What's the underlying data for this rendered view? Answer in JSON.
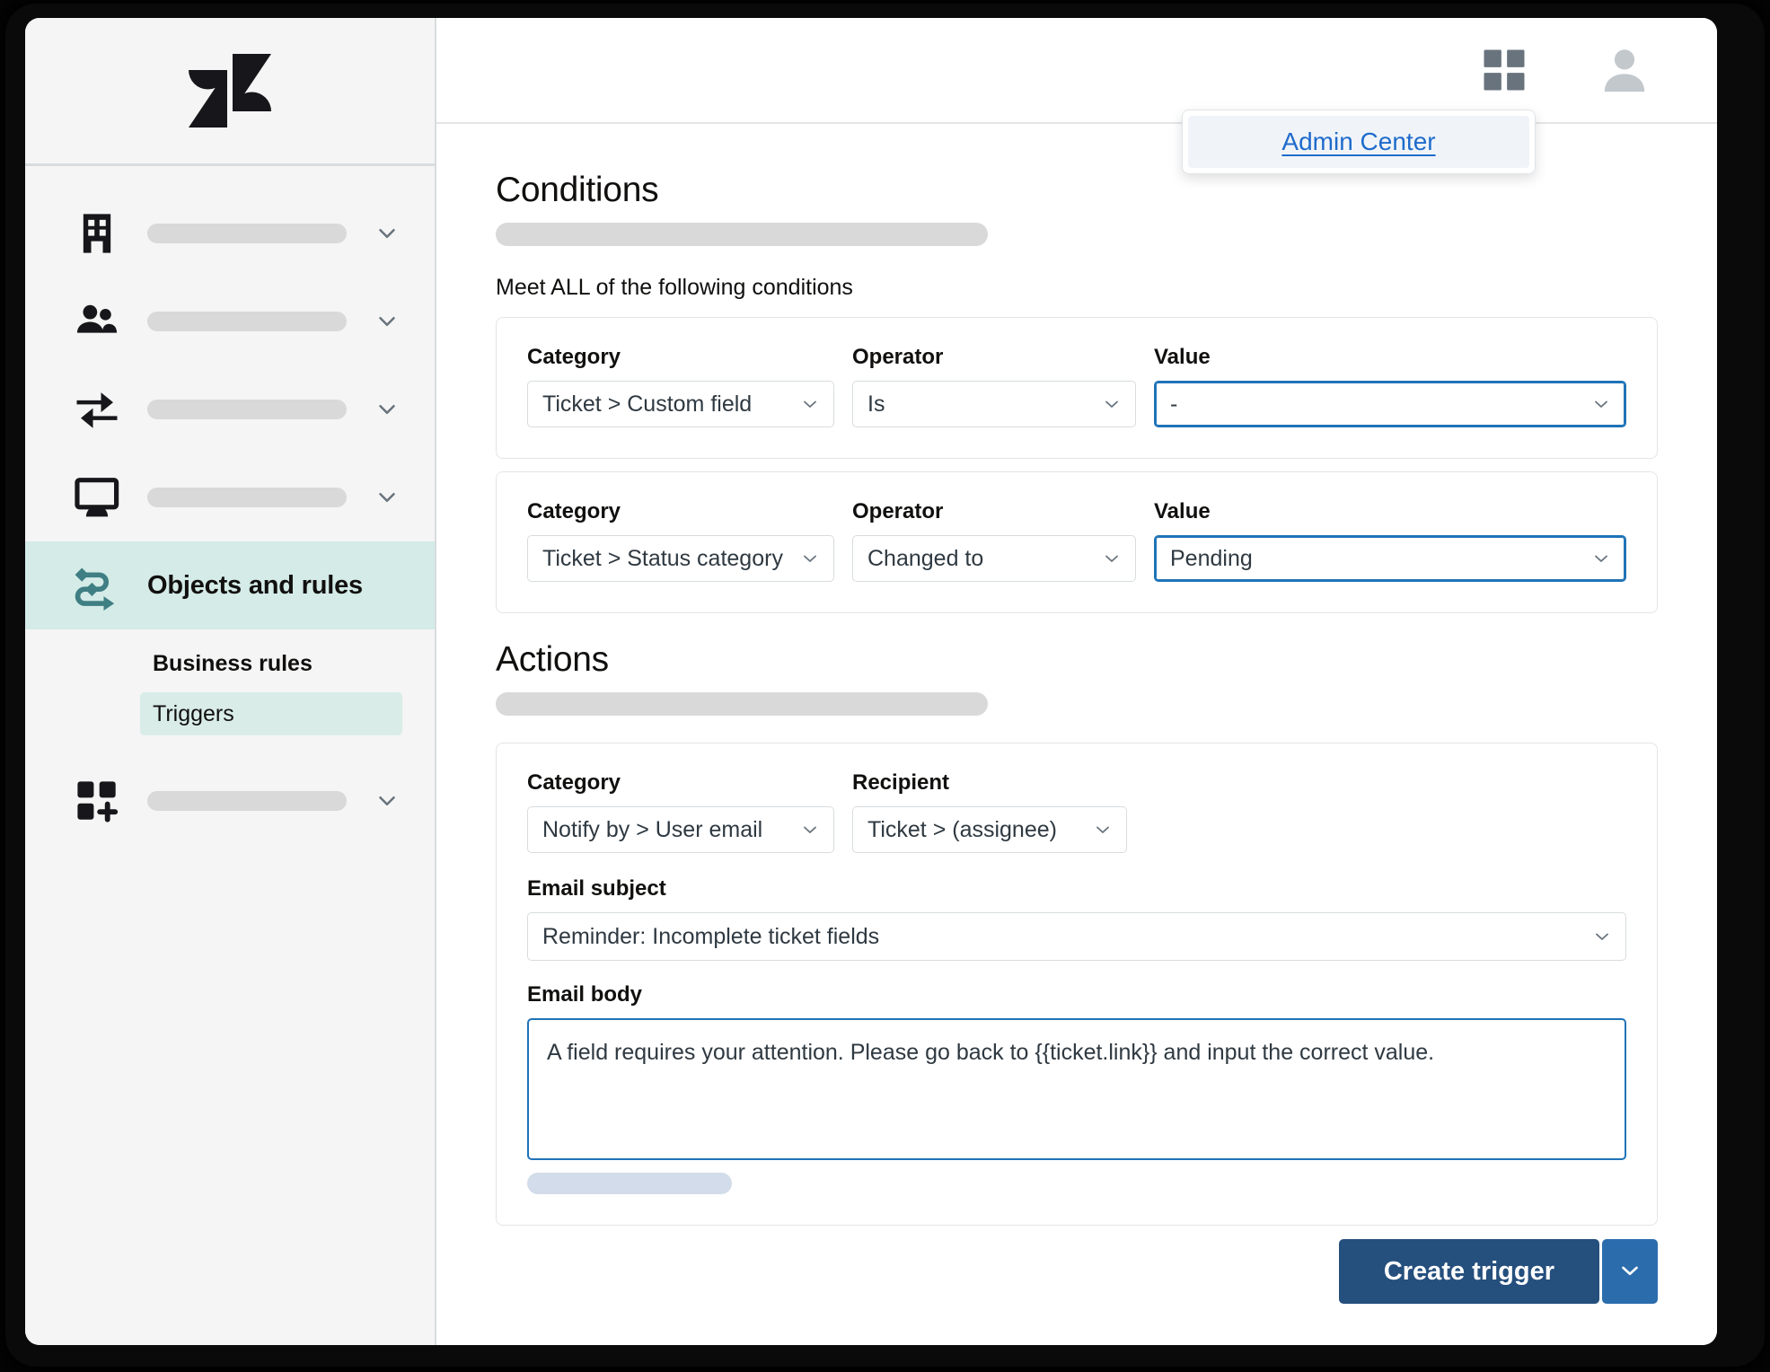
{
  "sidebar": {
    "logo": "zendesk-logo",
    "items": [
      {
        "icon": "building-icon",
        "label": "",
        "placeholder": true,
        "active": false,
        "chevron": true
      },
      {
        "icon": "people-icon",
        "label": "",
        "placeholder": true,
        "active": false,
        "chevron": true
      },
      {
        "icon": "transfer-arrows-icon",
        "label": "",
        "placeholder": true,
        "active": false,
        "chevron": true
      },
      {
        "icon": "monitor-icon",
        "label": "",
        "placeholder": true,
        "active": false,
        "chevron": true
      },
      {
        "icon": "objects-rules-icon",
        "label": "Objects and rules",
        "placeholder": false,
        "active": true,
        "chevron": false
      },
      {
        "icon": "apps-add-icon",
        "label": "",
        "placeholder": true,
        "active": false,
        "chevron": true
      }
    ],
    "sub_items": [
      {
        "label": "Business rules",
        "heading": true,
        "selected": false
      },
      {
        "label": "Triggers",
        "heading": false,
        "selected": true
      }
    ]
  },
  "topbar": {
    "products_icon": "grid-apps-icon",
    "avatar_icon": "user-avatar-icon",
    "popover": {
      "link_label": "Admin Center"
    }
  },
  "conditions": {
    "title": "Conditions",
    "subtitle": "Meet ALL of the following conditions",
    "labels": {
      "category": "Category",
      "operator": "Operator",
      "value": "Value"
    },
    "rows": [
      {
        "category": "Ticket > Custom field",
        "operator": "Is",
        "value": "-",
        "value_focused": true
      },
      {
        "category": "Ticket > Status category",
        "operator": "Changed to",
        "value": "Pending",
        "value_focused": true
      }
    ]
  },
  "actions": {
    "title": "Actions",
    "labels": {
      "category": "Category",
      "recipient": "Recipient",
      "email_subject": "Email subject",
      "email_body": "Email body"
    },
    "category": "Notify by > User email",
    "recipient": "Ticket > (assignee)",
    "email_subject": "Reminder: Incomplete ticket fields",
    "email_body": "A field requires your attention. Please go back to {{ticket.link}} and input the correct value."
  },
  "footer": {
    "primary_label": "Create trigger",
    "split_icon": "chevron-down-icon"
  },
  "colors": {
    "accent_teal": "#d4ebe7",
    "sub_selected": "#d9ece8",
    "focus_blue": "#1f73b7",
    "link_blue": "#1f6bcc",
    "primary_button": "#254f7d",
    "split_button": "#2b6cad"
  }
}
